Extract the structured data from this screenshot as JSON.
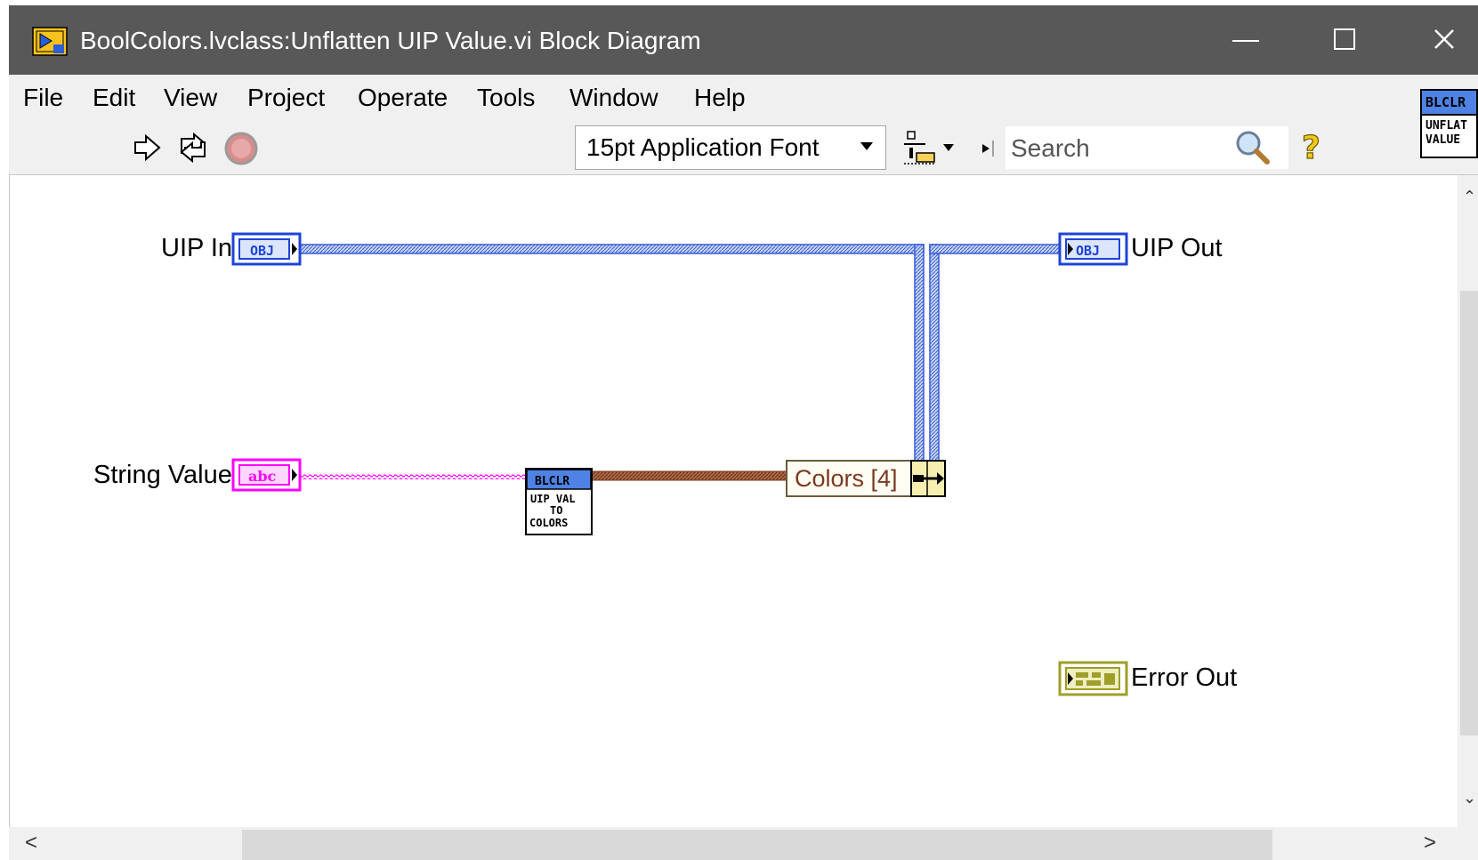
{
  "window": {
    "title": "BoolColors.lvclass:Unflatten UIP Value.vi Block Diagram"
  },
  "menu": [
    "File",
    "Edit",
    "View",
    "Project",
    "Operate",
    "Tools",
    "Window",
    "Help"
  ],
  "toolbar": {
    "font_select": "15pt Application Font",
    "search_placeholder": "Search",
    "help_glyph": "?"
  },
  "vi_icon": {
    "header": "BLCLR",
    "body": "UNFLAT\nVALUE"
  },
  "diagram": {
    "uip_in_label": "UIP In",
    "uip_in_terminal": "OBJ",
    "string_value_label": "String Value",
    "string_value_terminal": "abc",
    "subvi_header": "BLCLR",
    "subvi_body": "UIP VAL\nTO\nCOLORS",
    "property_node_label": "Colors [4]",
    "uip_out_label": "UIP Out",
    "uip_out_terminal": "OBJ",
    "error_out_label": "Error Out"
  },
  "colors": {
    "titlebar": "#585858",
    "object_wire": "#3a5bd6",
    "string_wire": "#ff00ff",
    "cluster_wire": "#8b4a2a",
    "error_terminal": "#9e9e2a"
  },
  "icons": {
    "run": "run-arrow-icon",
    "run_continuous": "run-continuously-icon",
    "abort": "abort-execution-icon",
    "search": "search-icon",
    "help": "help-icon"
  }
}
